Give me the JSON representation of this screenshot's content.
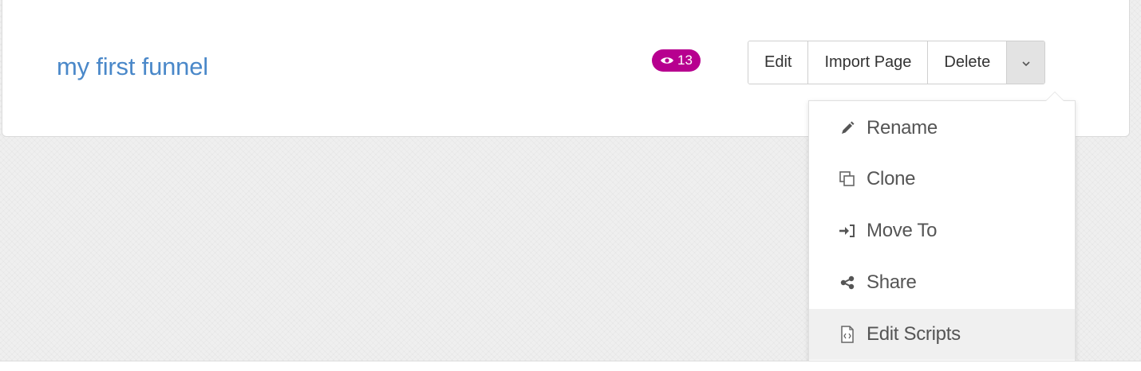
{
  "funnel": {
    "name": "my first funnel",
    "views": "13"
  },
  "actions": {
    "edit_label": "Edit",
    "import_label": "Import Page",
    "delete_label": "Delete"
  },
  "dropdown": {
    "items": [
      {
        "label": "Rename",
        "icon": "pencil-icon"
      },
      {
        "label": "Clone",
        "icon": "clone-icon"
      },
      {
        "label": "Move To",
        "icon": "move-to-icon"
      },
      {
        "label": "Share",
        "icon": "share-icon"
      },
      {
        "label": "Edit Scripts",
        "icon": "script-file-icon",
        "highlighted": true
      }
    ]
  },
  "colors": {
    "link": "#4a88c9",
    "badge": "#b7008f"
  }
}
